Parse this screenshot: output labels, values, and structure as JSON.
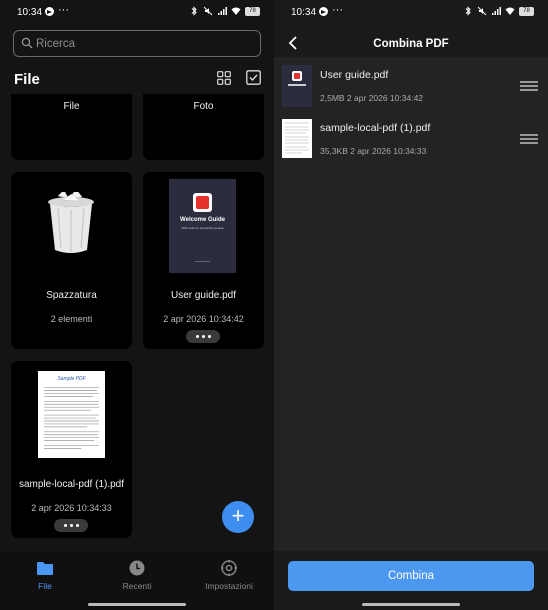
{
  "status": {
    "time": "10:34",
    "dots": "···",
    "battery": "78"
  },
  "left": {
    "search": {
      "placeholder": "Ricerca"
    },
    "heading": "File",
    "cards": [
      {
        "name": "File"
      },
      {
        "name": "Foto"
      },
      {
        "name": "Spazzatura",
        "sub": "2 elementi"
      },
      {
        "name": "User guide.pdf",
        "sub": "2 apr 2026 10:34:42"
      },
      {
        "name": "sample-local-pdf (1).pdf",
        "sub": "2 apr 2026 10:34:33"
      }
    ],
    "thumb_userguide": {
      "title": "Welcome Guide",
      "subtitle": "PDF tools for productive people"
    },
    "thumb_sample": {
      "title": "Sample PDF"
    },
    "fab": "+",
    "nav": [
      {
        "label": "File",
        "active": true
      },
      {
        "label": "Recenti",
        "active": false
      },
      {
        "label": "Impostazioni",
        "active": false
      }
    ]
  },
  "right": {
    "title": "Combina PDF",
    "files": [
      {
        "name": "User guide.pdf",
        "meta": "2,5MB 2 apr 2026 10:34:42"
      },
      {
        "name": "sample-local-pdf (1).pdf",
        "meta": "35,3KB 2 apr 2026 10:34:33"
      }
    ],
    "button": "Combina"
  },
  "colors": {
    "accent": "#3d8ef0",
    "button": "#4c97f0",
    "background_left": "#141414",
    "background_right": "#232323"
  }
}
